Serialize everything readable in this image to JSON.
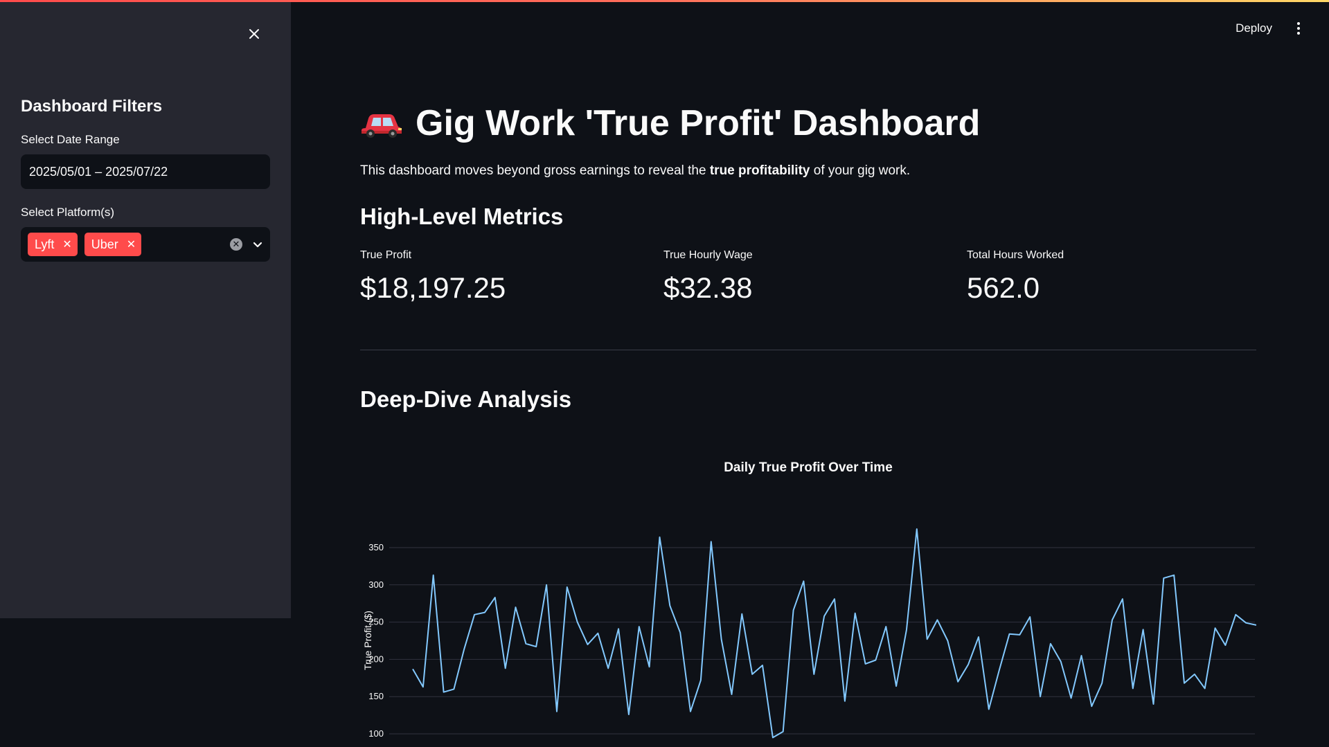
{
  "header": {
    "deploy_label": "Deploy"
  },
  "sidebar": {
    "title": "Dashboard Filters",
    "date_range": {
      "label": "Select Date Range",
      "value": "2025/05/01 – 2025/07/22"
    },
    "platforms": {
      "label": "Select Platform(s)",
      "selected": [
        "Lyft",
        "Uber"
      ]
    }
  },
  "main": {
    "title": "Gig Work 'True Profit' Dashboard",
    "intro_prefix": "This dashboard moves beyond gross earnings to reveal the ",
    "intro_bold": "true profitability",
    "intro_suffix": " of your gig work.",
    "metrics_heading": "High-Level Metrics",
    "metrics": [
      {
        "label": "True Profit",
        "value": "$18,197.25"
      },
      {
        "label": "True Hourly Wage",
        "value": "$32.38"
      },
      {
        "label": "Total Hours Worked",
        "value": "562.0"
      }
    ],
    "analysis_heading": "Deep-Dive Analysis"
  },
  "colors": {
    "accent": "#ff4b4b",
    "line": "#83c9ff",
    "background": "#0e1117",
    "sidebar": "#262730"
  },
  "chart_data": {
    "type": "line",
    "title": "Daily True Profit Over Time",
    "xlabel": "",
    "ylabel": "True Profit ($)",
    "yticks": [
      100,
      150,
      200,
      250,
      300,
      350
    ],
    "ylim": [
      90,
      375
    ],
    "grid": true,
    "series": [
      {
        "values": [
          187,
          163,
          313,
          156,
          160,
          214,
          260,
          263,
          283,
          188,
          270,
          221,
          217,
          300,
          130,
          297,
          250,
          220,
          235,
          188,
          241,
          126,
          244,
          190,
          364,
          272,
          236,
          130,
          172,
          358,
          227,
          153,
          261,
          180,
          192,
          95,
          103,
          266,
          305,
          180,
          258,
          281,
          144,
          262,
          194,
          199,
          244,
          164,
          240,
          375,
          227,
          253,
          225,
          170,
          193,
          230,
          133,
          185,
          234,
          233,
          257,
          150,
          221,
          197,
          148,
          205,
          137,
          168,
          253,
          281,
          161,
          240,
          140,
          309,
          313,
          168,
          180,
          161,
          242,
          219,
          260,
          249,
          246
        ]
      }
    ]
  }
}
